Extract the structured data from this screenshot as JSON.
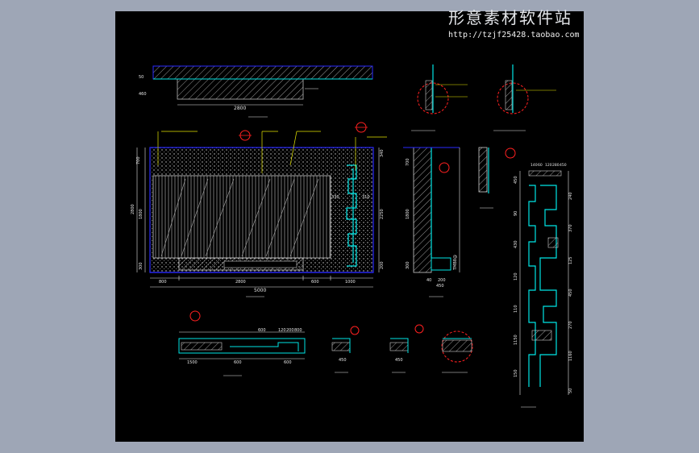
{
  "watermark": {
    "title": "形意素材软件站",
    "url": "http://tzjf25428.taobao.com"
  },
  "colors": {
    "background": "#9ea6b6",
    "canvas": "#000000",
    "dim": "#e6e6e6",
    "frame": "#2a2aff",
    "cyan": "#00e5e5",
    "yellow": "#e6e600",
    "red": "#ff2020",
    "green": "#20ff20",
    "magenta": "#ff40ff"
  },
  "top_plan": {
    "width_dim": "2800",
    "side_dims": [
      "50",
      "460"
    ]
  },
  "elevation": {
    "total_width": "5000",
    "bottom_dims": [
      "800",
      "2800",
      "600",
      "1000"
    ],
    "left_dims": [
      "700",
      "2800",
      "1800",
      "300"
    ],
    "right_dims": [
      "340",
      "2250",
      "200"
    ],
    "inner_dims": [
      "330",
      "310"
    ]
  },
  "section_1": {
    "left_dims": [
      "700",
      "1800",
      "300"
    ],
    "bottom_dims": [
      "40",
      "200",
      "450"
    ],
    "side_label": "TMB8@"
  },
  "plan_bottom": {
    "dims": [
      "1500",
      "600",
      "600",
      "600",
      "120",
      "200",
      "800"
    ]
  },
  "detail_3": {
    "width": "450"
  },
  "detail_4": {
    "width": "450"
  },
  "tall_section": {
    "dims": [
      "450",
      "240",
      "90",
      "370",
      "430",
      "125",
      "120",
      "450",
      "110",
      "270",
      "1150",
      "1160",
      "150",
      "50"
    ]
  },
  "detail_top_dims": [
    "140",
    "60",
    "120",
    "280",
    "450"
  ]
}
